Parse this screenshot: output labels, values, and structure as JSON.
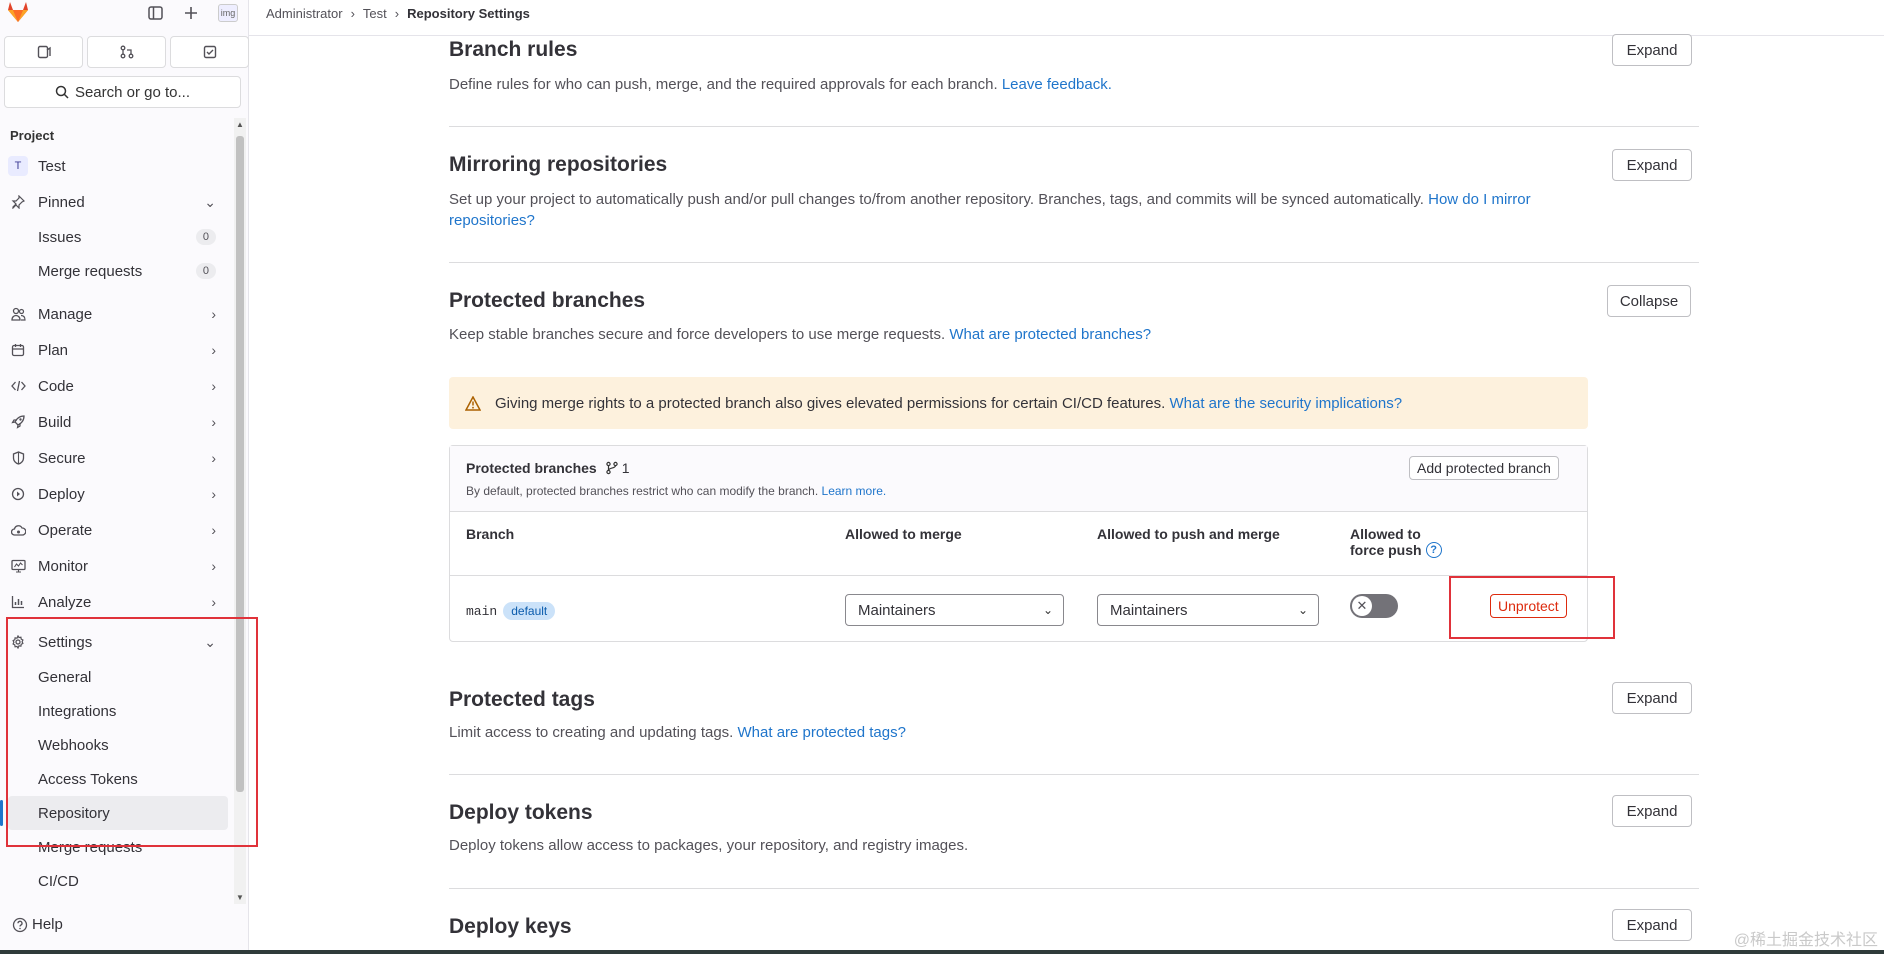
{
  "breadcrumb": {
    "items": [
      "Administrator",
      "Test"
    ],
    "current": "Repository Settings"
  },
  "sidebar": {
    "search_placeholder": "Search or go to...",
    "section_label": "Project",
    "project": {
      "initial": "T",
      "name": "Test"
    },
    "pinned": {
      "label": "Pinned",
      "items": [
        {
          "label": "Issues",
          "count": "0"
        },
        {
          "label": "Merge requests",
          "count": "0"
        }
      ]
    },
    "nav": [
      "Manage",
      "Plan",
      "Code",
      "Build",
      "Secure",
      "Deploy",
      "Operate",
      "Monitor",
      "Analyze"
    ],
    "settings": {
      "label": "Settings",
      "items": [
        "General",
        "Integrations",
        "Webhooks",
        "Access Tokens",
        "Repository",
        "Merge requests",
        "CI/CD"
      ],
      "active": "Repository"
    },
    "help": "Help",
    "avatar_alt": "img"
  },
  "sections": {
    "branch_rules": {
      "title": "Branch rules",
      "desc": "Define rules for who can push, merge, and the required approvals for each branch.",
      "link": "Leave feedback.",
      "button": "Expand"
    },
    "mirroring": {
      "title": "Mirroring repositories",
      "desc": "Set up your project to automatically push and/or pull changes to/from another repository. Branches, tags, and commits will be synced automatically.",
      "link": "How do I mirror repositories?",
      "button": "Expand"
    },
    "protected_branches": {
      "title": "Protected branches",
      "desc": "Keep stable branches secure and force developers to use merge requests.",
      "link": "What are protected branches?",
      "button": "Collapse",
      "alert": "Giving merge rights to a protected branch also gives elevated permissions for certain CI/CD features.",
      "alert_link": "What are the security implications?",
      "card": {
        "title": "Protected branches",
        "count": "1",
        "subtitle": "By default, protected branches restrict who can modify the branch.",
        "subtitle_link": "Learn more.",
        "add_button": "Add protected branch",
        "columns": {
          "branch": "Branch",
          "merge": "Allowed to merge",
          "push": "Allowed to push and merge",
          "force_line1": "Allowed to",
          "force_line2": "force push"
        },
        "row": {
          "branch": "main",
          "badge": "default",
          "merge": "Maintainers",
          "push": "Maintainers",
          "force_push": false,
          "action": "Unprotect"
        }
      }
    },
    "protected_tags": {
      "title": "Protected tags",
      "desc": "Limit access to creating and updating tags.",
      "link": "What are protected tags?",
      "button": "Expand"
    },
    "deploy_tokens": {
      "title": "Deploy tokens",
      "desc": "Deploy tokens allow access to packages, your repository, and registry images.",
      "button": "Expand"
    },
    "deploy_keys": {
      "title": "Deploy keys",
      "button": "Expand"
    }
  },
  "watermark": "@稀土掘金技术社区",
  "colors": {
    "accent": "#1f75cb",
    "danger": "#dd2b0e",
    "highlight_box": "#e0323a",
    "alert_bg": "#fdf1dd"
  }
}
